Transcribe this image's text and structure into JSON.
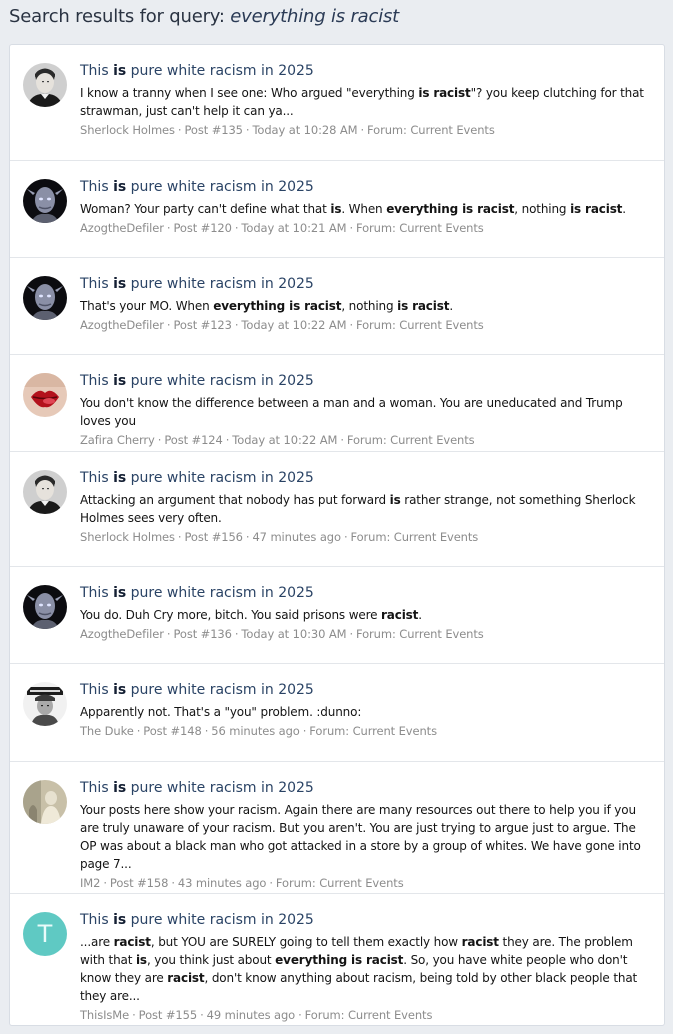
{
  "header": {
    "prefix": "Search results for query: ",
    "query": "everything is racist"
  },
  "results": [
    {
      "avatar": "sherlock-holmes-avatar",
      "title_pre": "This ",
      "title_bold": "is",
      "title_post": " pure white racism in 2025",
      "snippet": [
        {
          "t": "I know a tranny when I see one: Who argued \"everything "
        },
        {
          "t": "is racist",
          "b": true
        },
        {
          "t": "\"? you keep clutching for that strawman, just can't help it can ya..."
        }
      ],
      "author": "Sherlock Holmes",
      "post": "Post #135",
      "time": "Today at 10:28 AM",
      "forum": "Forum: Current Events"
    },
    {
      "avatar": "azog-avatar",
      "title_pre": "This ",
      "title_bold": "is",
      "title_post": " pure white racism in 2025",
      "snippet": [
        {
          "t": "Woman? Your party can't define what that "
        },
        {
          "t": "is",
          "b": true
        },
        {
          "t": ". When "
        },
        {
          "t": "everything is racist",
          "b": true
        },
        {
          "t": ", nothing "
        },
        {
          "t": "is racist",
          "b": true
        },
        {
          "t": "."
        }
      ],
      "author": "AzogtheDefiler",
      "post": "Post #120",
      "time": "Today at 10:21 AM",
      "forum": "Forum: Current Events"
    },
    {
      "avatar": "azog-avatar",
      "title_pre": "This ",
      "title_bold": "is",
      "title_post": " pure white racism in 2025",
      "snippet": [
        {
          "t": "That's your MO. When "
        },
        {
          "t": "everything is racist",
          "b": true
        },
        {
          "t": ", nothing "
        },
        {
          "t": "is racist",
          "b": true
        },
        {
          "t": "."
        }
      ],
      "author": "AzogtheDefiler",
      "post": "Post #123",
      "time": "Today at 10:22 AM",
      "forum": "Forum: Current Events"
    },
    {
      "avatar": "lips-avatar",
      "title_pre": "This ",
      "title_bold": "is",
      "title_post": " pure white racism in 2025",
      "snippet": [
        {
          "t": "You don't know the difference between a man and a woman. You are uneducated and Trump loves you"
        }
      ],
      "author": "Zafira Cherry",
      "post": "Post #124",
      "time": "Today at 10:22 AM",
      "forum": "Forum: Current Events"
    },
    {
      "avatar": "sherlock-holmes-avatar",
      "title_pre": "This ",
      "title_bold": "is",
      "title_post": " pure white racism in 2025",
      "snippet": [
        {
          "t": "Attacking an argument that nobody has put forward "
        },
        {
          "t": "is",
          "b": true
        },
        {
          "t": " rather strange, not something Sherlock Holmes sees very often."
        }
      ],
      "author": "Sherlock Holmes",
      "post": "Post #156",
      "time": "47 minutes ago",
      "forum": "Forum: Current Events"
    },
    {
      "avatar": "azog-avatar",
      "title_pre": "This ",
      "title_bold": "is",
      "title_post": " pure white racism in 2025",
      "snippet": [
        {
          "t": "You do. Duh Cry more, bitch. You said prisons were "
        },
        {
          "t": "racist",
          "b": true
        },
        {
          "t": "."
        }
      ],
      "author": "AzogtheDefiler",
      "post": "Post #136",
      "time": "Today at 10:30 AM",
      "forum": "Forum: Current Events"
    },
    {
      "avatar": "the-duke-avatar",
      "title_pre": "This ",
      "title_bold": "is",
      "title_post": " pure white racism in 2025",
      "snippet": [
        {
          "t": "Apparently not. That's a \"you\" problem. :dunno:"
        }
      ],
      "author": "The Duke",
      "post": "Post #148",
      "time": "56 minutes ago",
      "forum": "Forum: Current Events"
    },
    {
      "avatar": "im2-avatar",
      "title_pre": "This ",
      "title_bold": "is",
      "title_post": " pure white racism in 2025",
      "snippet": [
        {
          "t": "Your posts here show your racism. Again there are many resources out there to help you if you are truly unaware of your racism. But you aren't. You are just trying to argue just to argue. The OP was about a black man who got attacked in a store by a group of whites. We have gone into page 7..."
        }
      ],
      "author": "IM2",
      "post": "Post #158",
      "time": "43 minutes ago",
      "forum": "Forum: Current Events"
    },
    {
      "avatar": "letter-t-avatar",
      "avatar_letter": "T",
      "title_pre": "This ",
      "title_bold": "is",
      "title_post": " pure white racism in 2025",
      "snippet": [
        {
          "t": "...are "
        },
        {
          "t": "racist",
          "b": true
        },
        {
          "t": ", but YOU are SURELY going to tell them exactly how "
        },
        {
          "t": "racist",
          "b": true
        },
        {
          "t": " they are. The problem with that "
        },
        {
          "t": "is",
          "b": true
        },
        {
          "t": ", you think just about "
        },
        {
          "t": "everything is racist",
          "b": true
        },
        {
          "t": ". So, you have white people who don't know they are "
        },
        {
          "t": "racist",
          "b": true
        },
        {
          "t": ", don't know anything about racism, being told by other black people that they are..."
        }
      ],
      "author": "ThisIsMe",
      "post": "Post #155",
      "time": "49 minutes ago",
      "forum": "Forum: Current Events"
    }
  ]
}
